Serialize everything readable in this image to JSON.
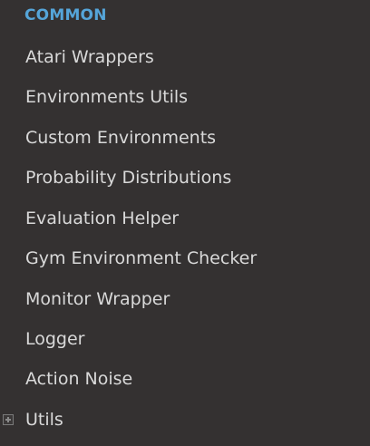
{
  "section": {
    "caption": "COMMON"
  },
  "menu": {
    "items": [
      {
        "label": "Atari Wrappers"
      },
      {
        "label": "Environments Utils"
      },
      {
        "label": "Custom Environments"
      },
      {
        "label": "Probability Distributions"
      },
      {
        "label": "Evaluation Helper"
      },
      {
        "label": "Gym Environment Checker"
      },
      {
        "label": "Monitor Wrapper"
      },
      {
        "label": "Logger"
      },
      {
        "label": "Action Noise"
      },
      {
        "label": "Utils",
        "expandable": true,
        "icon": "plus-square-icon"
      }
    ]
  }
}
